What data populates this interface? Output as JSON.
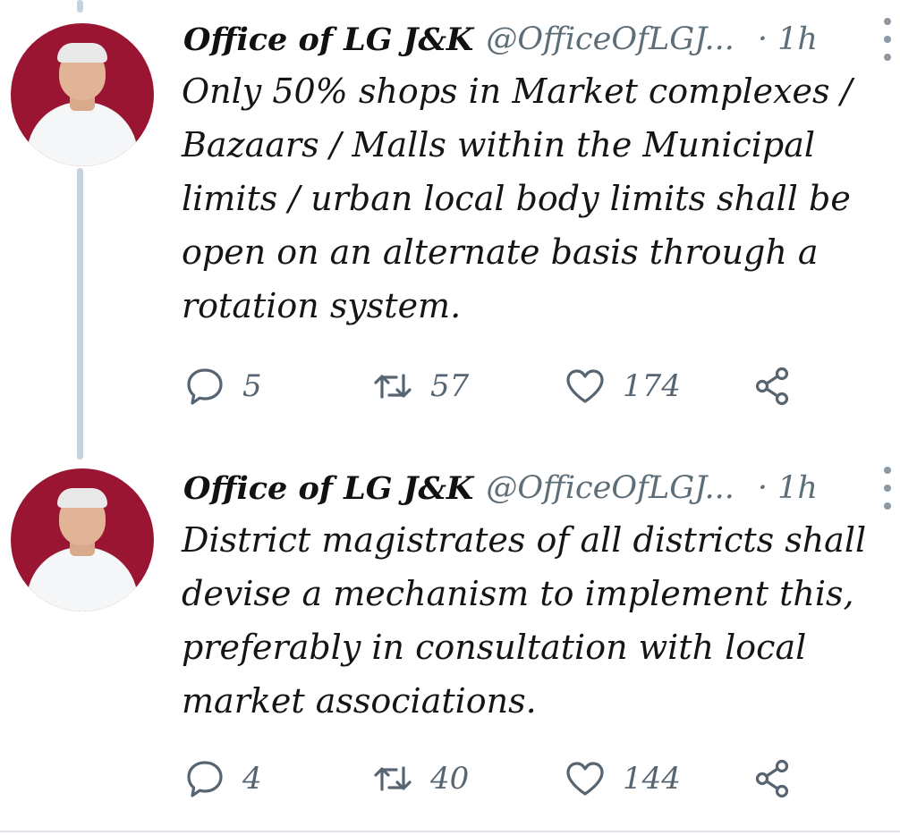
{
  "tweets": [
    {
      "display_name": "Office of LG J&K",
      "handle": "@OfficeOfLGJ...",
      "time": "· 1h",
      "text_lines": [
        "Only 50% shops in Market complexes /",
        "Bazaars / Malls within the Municipal",
        "limits / urban local body limits shall be",
        "open on an alternate basis through a",
        "rotation system."
      ],
      "replies": "5",
      "retweets": "57",
      "likes": "174"
    },
    {
      "display_name": "Office of LG J&K",
      "handle": "@OfficeOfLGJ...",
      "time": "· 1h",
      "text_lines": [
        "District magistrates of all districts shall",
        "devise a mechanism to implement this,",
        "preferably in consultation with local",
        "market associations."
      ],
      "replies": "4",
      "retweets": "40",
      "likes": "144"
    }
  ],
  "icons": {
    "reply": "reply-icon",
    "retweet": "retweet-icon",
    "like": "heart-icon",
    "share": "share-icon",
    "more": "more-vertical-icon"
  },
  "colors": {
    "avatar_bg": "#9a1532",
    "thread_line": "#c7d3dc",
    "muted_text": "#5e6e79",
    "icon": "#566571"
  }
}
